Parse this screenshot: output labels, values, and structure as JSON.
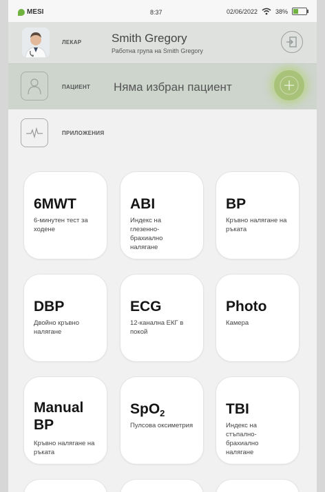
{
  "status_bar": {
    "brand": "MESI",
    "time": "8:37",
    "date": "02/06/2022",
    "battery": "38%",
    "battery_level_pct": 38
  },
  "doctor": {
    "label": "ЛЕКАР",
    "name": "Smith Gregory",
    "group": "Работна група на Smith Gregory"
  },
  "patient": {
    "label": "ПАЦИЕНТ",
    "status": "Няма избран пациент"
  },
  "apps": {
    "label": "ПРИЛОЖЕНИЯ"
  },
  "tiles": [
    {
      "title": "6MWT",
      "desc": "6-минутен тест за ходене"
    },
    {
      "title": "ABI",
      "desc": "Индекс на глезенно-брахиално налягане"
    },
    {
      "title": "BP",
      "desc": "Кръвно налягане на ръката"
    },
    {
      "title": "DBP",
      "desc": "Двойно кръвно налягане"
    },
    {
      "title": "ECG",
      "desc": "12-канална ЕКГ в покой"
    },
    {
      "title": "Photo",
      "desc": "Камера"
    },
    {
      "title": "Manual BP",
      "title_line1": "Manual",
      "title_line2": "BP",
      "desc": "Кръвно налягане на ръката"
    },
    {
      "title": "SpO2",
      "title_main": "SpO",
      "title_sub": "2",
      "desc": "Пулсова оксиметрия"
    },
    {
      "title": "TBI",
      "desc": "Индекс на стъпално-брахиално налягане"
    }
  ],
  "colors": {
    "accent_green": "#a9c27a",
    "brand_green": "#6fb23f",
    "patient_row_bg": "#cdd5cd"
  },
  "icons": [
    "mesi-logo-icon",
    "wifi-icon",
    "battery-icon",
    "doctor-avatar",
    "logout-icon",
    "patient-person-icon",
    "add-patient-icon",
    "pulse-wave-icon"
  ]
}
